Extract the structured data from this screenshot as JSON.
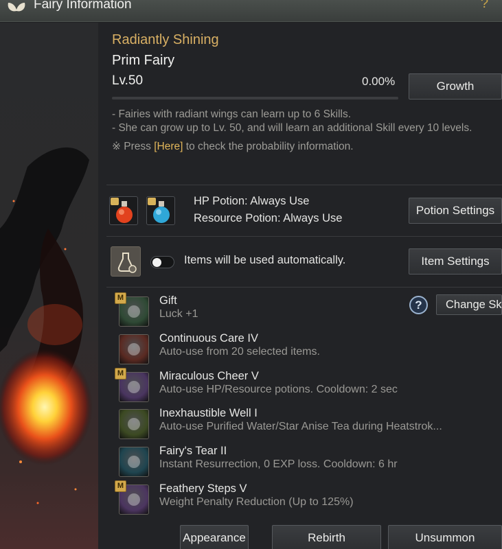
{
  "header": {
    "title": "Fairy Information",
    "help_glyph": "?"
  },
  "fairy": {
    "grade": "Radiantly Shining",
    "name": "Prim Fairy",
    "level": "Lv.50",
    "exp_percent_label": "0.00%",
    "exp_fraction": 0.0
  },
  "buttons": {
    "growth": "Growth",
    "potion_settings": "Potion Settings",
    "item_settings": "Item Settings",
    "change_skill": "Change Skill",
    "appearance": "Appearance",
    "rebirth": "Rebirth",
    "unsummon": "Unsummon"
  },
  "notes": {
    "line1": "- Fairies with radiant wings can learn up to 6 Skills.",
    "line2": "- She can grow up to Lv. 50, and will learn an additional Skill every 10 levels.",
    "line3_prefix": "※ Press ",
    "line3_link": "[Here]",
    "line3_suffix": " to check the probability information."
  },
  "potions": {
    "hp": "HP Potion: Always Use",
    "resource": "Resource Potion: Always Use"
  },
  "auto_items": {
    "label": "Items will be used automatically.",
    "enabled": false
  },
  "skills": [
    {
      "name": "Gift",
      "desc": "Luck +1",
      "badge": "M",
      "icon": "clover-icon",
      "color": "#2f4a35"
    },
    {
      "name": "Continuous Care IV",
      "desc": "Auto-use from 20 selected items.",
      "badge": "",
      "icon": "fairy-icon",
      "color": "#5a2a22"
    },
    {
      "name": "Miraculous Cheer V",
      "desc": "Auto-use HP/Resource potions. Cooldown: 2 sec",
      "badge": "M",
      "icon": "potion-cheer-icon",
      "color": "#4a3560"
    },
    {
      "name": "Inexhaustible Well I",
      "desc": "Auto-use Purified Water/Star Anise Tea during Heatstrok...",
      "badge": "",
      "icon": "tea-cup-icon",
      "color": "#3c4a22"
    },
    {
      "name": "Fairy's Tear II",
      "desc": "Instant Resurrection, 0 EXP loss. Cooldown: 6 hr",
      "badge": "",
      "icon": "winged-vase-icon",
      "color": "#1f4550"
    },
    {
      "name": "Feathery Steps V",
      "desc": "Weight Penalty Reduction (Up to 125%)",
      "badge": "M",
      "icon": "weight-arrow-icon",
      "color": "#4c3560"
    }
  ]
}
